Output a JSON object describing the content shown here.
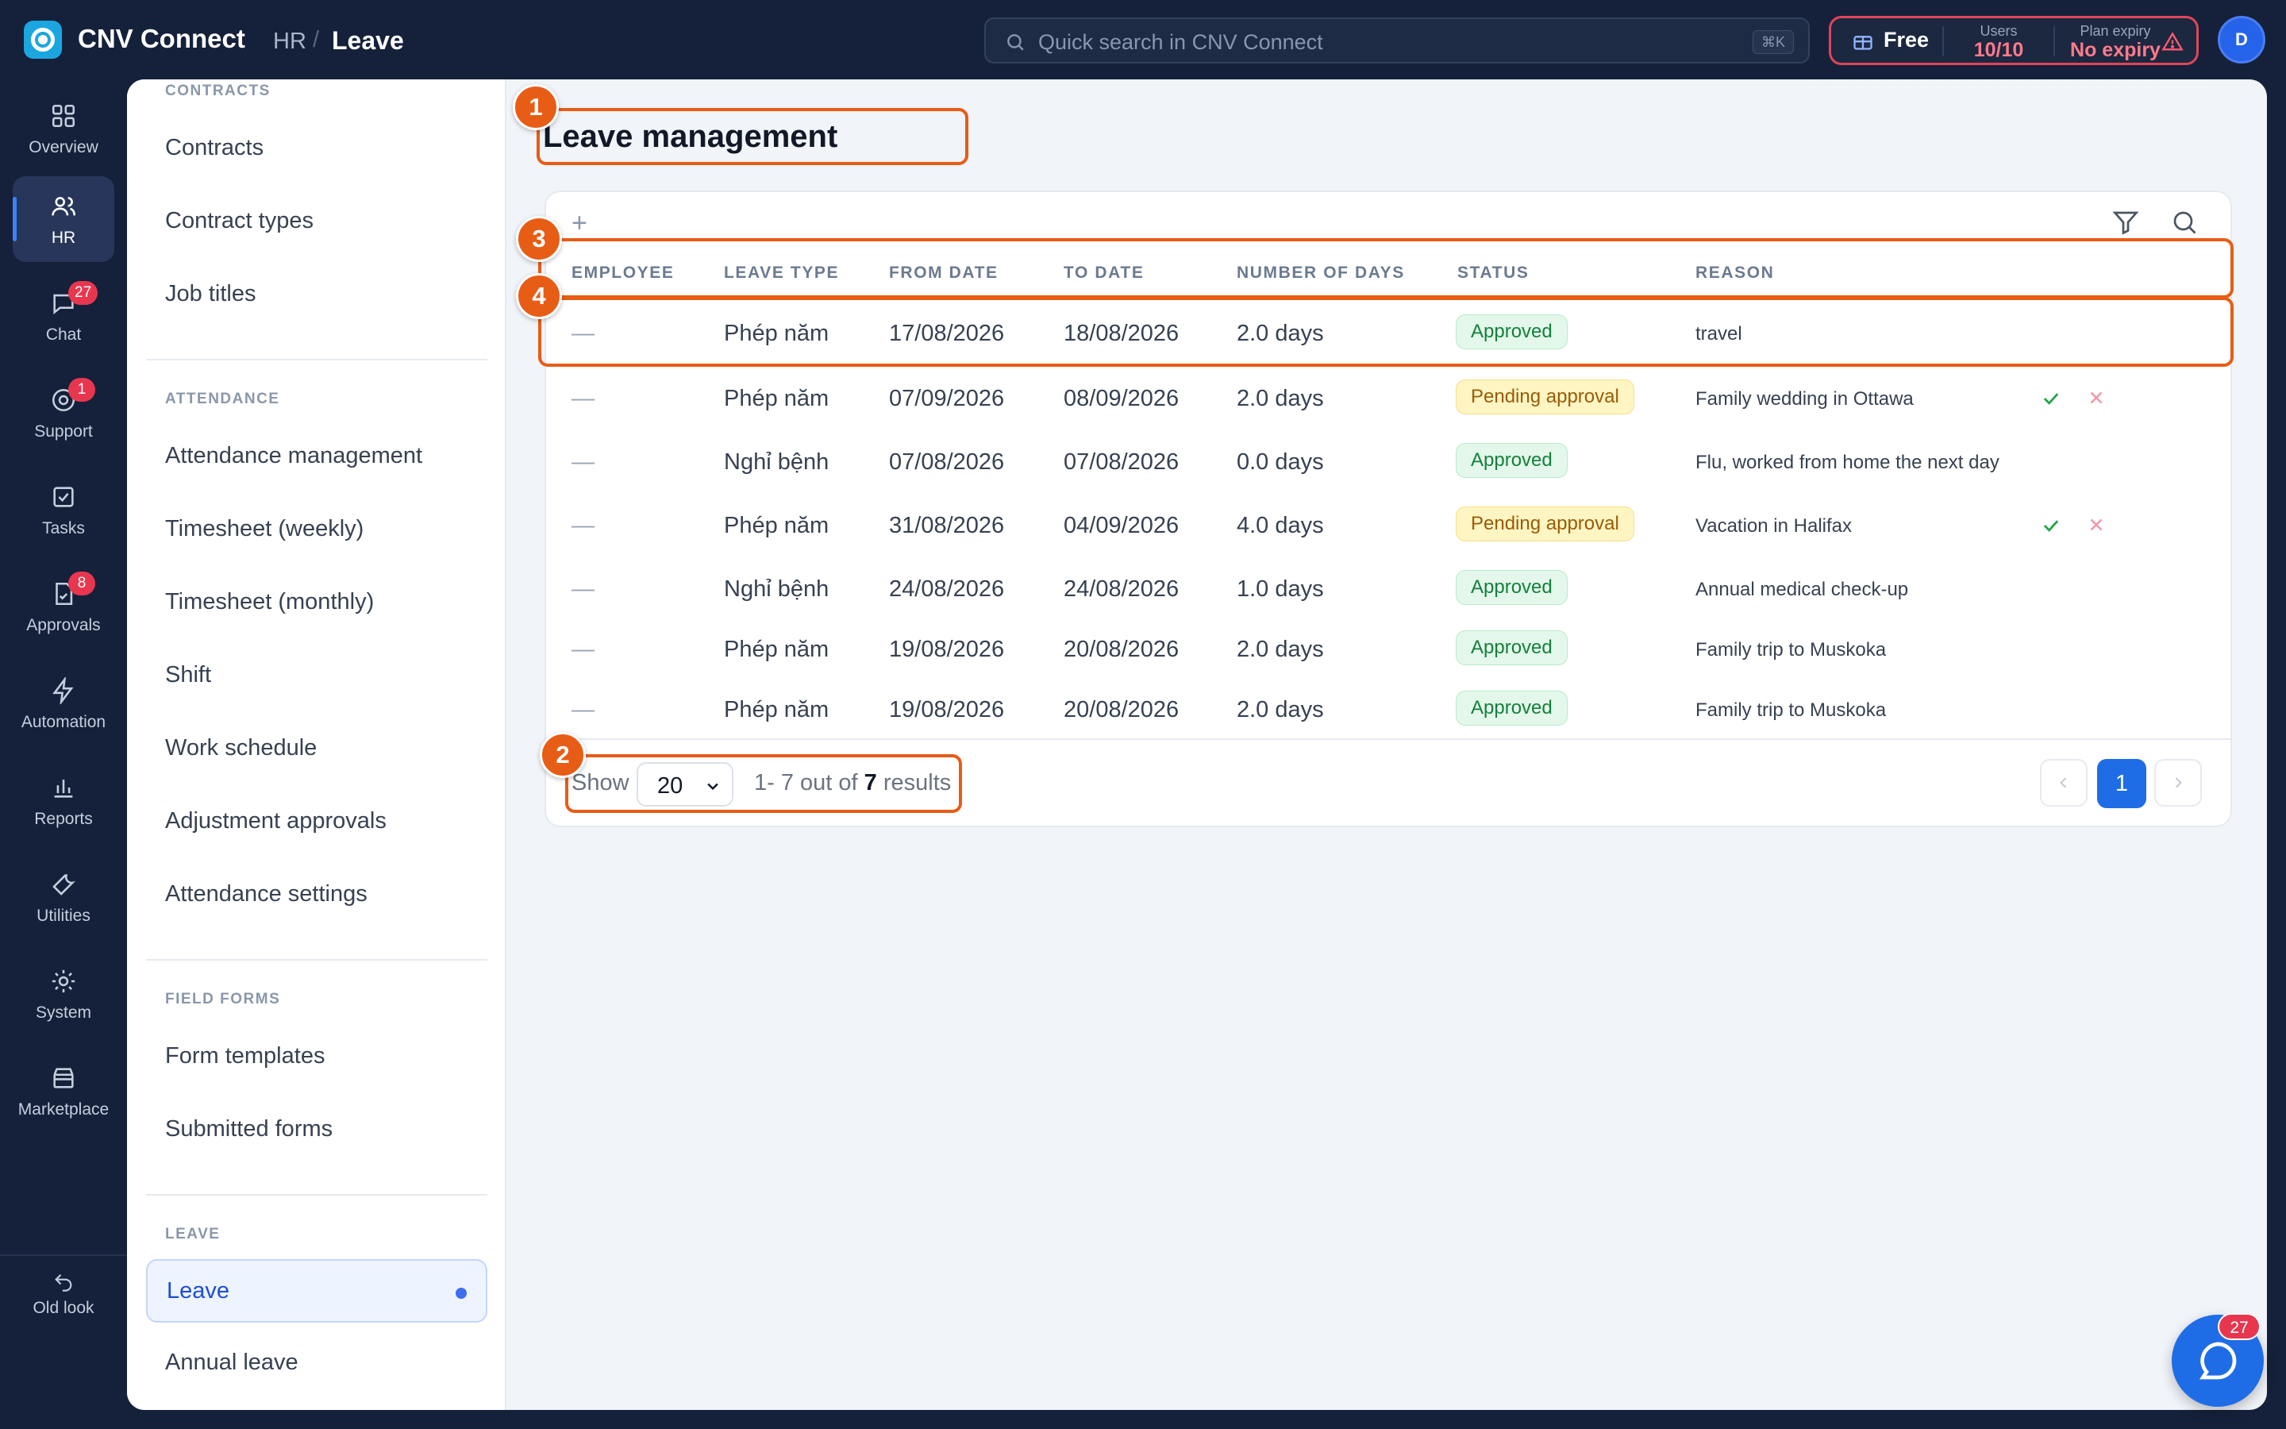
{
  "header": {
    "app_title": "CNV Connect",
    "breadcrumb": [
      "HR",
      "Leave"
    ],
    "breadcrumb_sep": "/",
    "search_placeholder": "Quick search in CNV Connect",
    "search_shortcut": "⌘K",
    "plan": {
      "name": "Free",
      "users_label": "Users",
      "users_value": "10/10",
      "expiry_label": "Plan expiry",
      "expiry_value": "No expiry"
    },
    "avatar_initial": "D"
  },
  "rail": {
    "items": [
      {
        "label": "Overview",
        "icon": "grid-icon"
      },
      {
        "label": "HR",
        "icon": "users-icon",
        "active": true
      },
      {
        "label": "Chat",
        "icon": "chat-icon",
        "badge": "27"
      },
      {
        "label": "Support",
        "icon": "support-icon",
        "badge": "1"
      },
      {
        "label": "Tasks",
        "icon": "tasks-icon"
      },
      {
        "label": "Approvals",
        "icon": "approvals-icon",
        "badge": "8"
      },
      {
        "label": "Automation",
        "icon": "bolt-icon"
      },
      {
        "label": "Reports",
        "icon": "reports-icon"
      },
      {
        "label": "Utilities",
        "icon": "wrench-icon"
      },
      {
        "label": "System",
        "icon": "gear-icon"
      },
      {
        "label": "Marketplace",
        "icon": "store-icon"
      }
    ],
    "old_look": "Old look"
  },
  "subnav": {
    "contracts_heading": "CONTRACTS",
    "contracts": [
      "Contracts",
      "Contract types",
      "Job titles"
    ],
    "attendance_heading": "ATTENDANCE",
    "attendance": [
      "Attendance management",
      "Timesheet (weekly)",
      "Timesheet (monthly)",
      "Shift",
      "Work schedule",
      "Adjustment approvals",
      "Attendance settings"
    ],
    "field_forms_heading": "FIELD FORMS",
    "field_forms": [
      "Form templates",
      "Submitted forms"
    ],
    "leave_heading": "LEAVE",
    "leave": [
      "Leave",
      "Annual leave"
    ]
  },
  "page": {
    "title": "Leave management",
    "add_symbol": "+"
  },
  "table": {
    "columns": [
      "EMPLOYEE",
      "LEAVE TYPE",
      "FROM DATE",
      "TO DATE",
      "NUMBER OF DAYS",
      "STATUS",
      "REASON"
    ],
    "rows": [
      {
        "employee": "—",
        "leave_type": "Phép năm",
        "from": "17/08/2026",
        "to": "18/08/2026",
        "days": "2.0 days",
        "status": "Approved",
        "reason": "travel"
      },
      {
        "employee": "—",
        "leave_type": "Phép năm",
        "from": "07/09/2026",
        "to": "08/09/2026",
        "days": "2.0 days",
        "status": "Pending approval",
        "reason": "Family wedding in Ottawa"
      },
      {
        "employee": "—",
        "leave_type": "Nghỉ bệnh",
        "from": "07/08/2026",
        "to": "07/08/2026",
        "days": "0.0 days",
        "status": "Approved",
        "reason": "Flu, worked from home the next day"
      },
      {
        "employee": "—",
        "leave_type": "Phép năm",
        "from": "31/08/2026",
        "to": "04/09/2026",
        "days": "4.0 days",
        "status": "Pending approval",
        "reason": "Vacation in Halifax"
      },
      {
        "employee": "—",
        "leave_type": "Nghỉ bệnh",
        "from": "24/08/2026",
        "to": "24/08/2026",
        "days": "1.0 days",
        "status": "Approved",
        "reason": "Annual medical check-up"
      },
      {
        "employee": "—",
        "leave_type": "Phép năm",
        "from": "19/08/2026",
        "to": "20/08/2026",
        "days": "2.0 days",
        "status": "Approved",
        "reason": "Family trip to Muskoka"
      },
      {
        "employee": "—",
        "leave_type": "Phép năm",
        "from": "19/08/2026",
        "to": "20/08/2026",
        "days": "2.0 days",
        "status": "Approved",
        "reason": "Family trip to Muskoka"
      }
    ]
  },
  "footer": {
    "show_label": "Show",
    "page_size": "20",
    "results_prefix": "1- 7 out of",
    "results_total": "7",
    "results_suffix": "results",
    "current_page": "1"
  },
  "annotations": [
    "1",
    "2",
    "3",
    "4"
  ],
  "chat_fab_badge": "27",
  "colors": {
    "sidebar_bg": "#15213a",
    "accent": "#1f6de6",
    "annotation": "#e85d16",
    "approved": "#15803d",
    "pending": "#9a5b06",
    "badge": "#e8364f"
  }
}
